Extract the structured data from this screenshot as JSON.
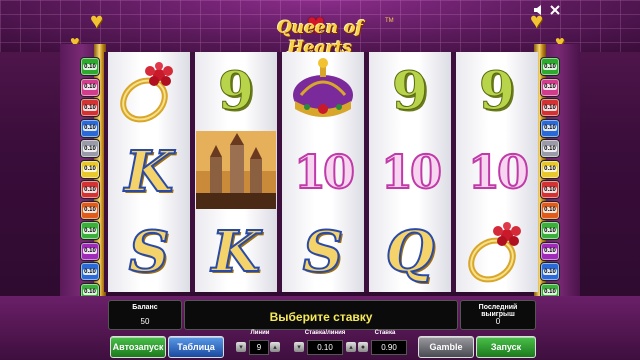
{
  "header": {
    "logo": "Queen of Hearts",
    "tm": "TM",
    "icons": [
      "speaker-icon",
      "close-icon"
    ]
  },
  "left_lines": [
    "0.10",
    "0.10",
    "0.10",
    "0.10",
    "0.10",
    "0.10",
    "0.10",
    "0.10",
    "0.10",
    "0.10",
    "0.10",
    "0.10"
  ],
  "right_lines": [
    "0.10",
    "0.10",
    "0.10",
    "0.10",
    "0.10",
    "0.10",
    "0.10",
    "0.10",
    "0.10",
    "0.10",
    "0.10",
    "0.10"
  ],
  "line_colors": [
    "#2fa82f",
    "#d23c8c",
    "#d43232",
    "#2a6ad8",
    "#9a9aa8",
    "#e8c82a",
    "#d43232",
    "#e05a1a",
    "#3ab03a",
    "#a02ab8",
    "#2a6ad8",
    "#3ab03a"
  ],
  "reels": [
    [
      "ring",
      "K",
      "S"
    ],
    [
      "9",
      "castle",
      "K"
    ],
    [
      "crown",
      "10",
      "S"
    ],
    [
      "9",
      "10",
      "Q"
    ],
    [
      "9",
      "10",
      "ring"
    ]
  ],
  "panel": {
    "balance_label": "Баланс",
    "balance_value": "50",
    "message": "Выберите ставку",
    "last_win_label": "Последний выигрыш",
    "last_win_value": "0",
    "autoplay": "Автозапуск",
    "paytable": "Таблица",
    "lines_label": "Линии",
    "lines_value": "9",
    "bet_line_label": "Ставка/линия",
    "bet_line_value": "0.10",
    "bet_label": "Ставка",
    "bet_value": "0.90",
    "gamble": "Gamble",
    "start": "Запуск"
  }
}
